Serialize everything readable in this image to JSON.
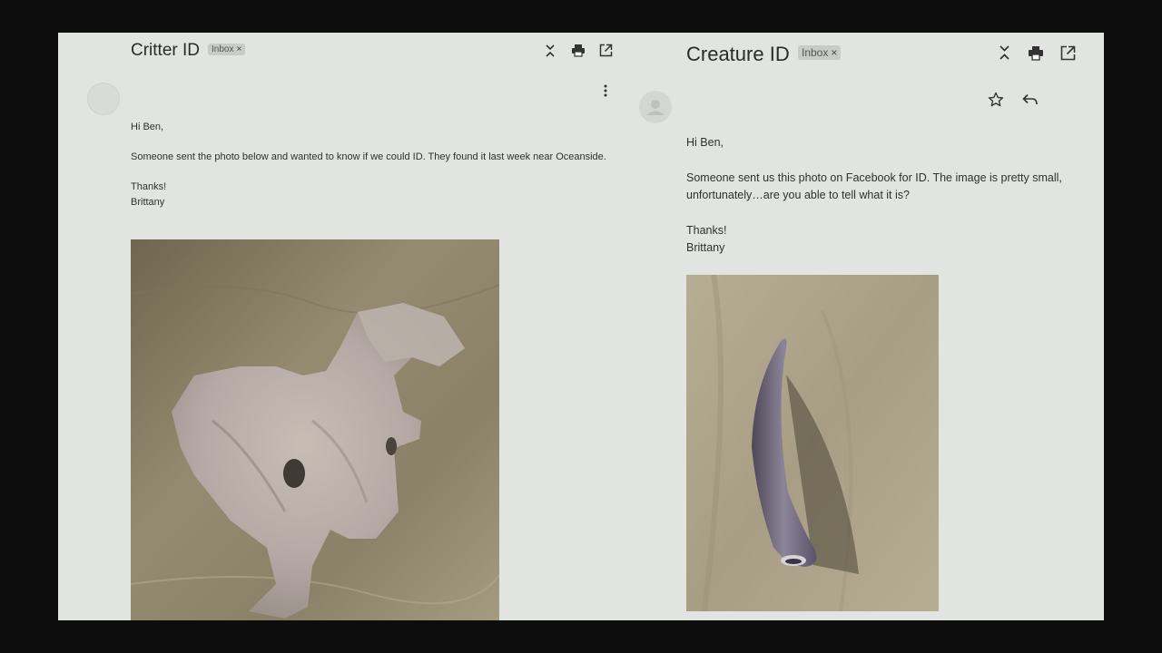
{
  "left_email": {
    "subject": "Critter ID",
    "label_chip": "Inbox",
    "chip_close": "×",
    "icons": [
      "expand-collapse-icon",
      "print-icon",
      "open-in-new-window-icon",
      "more-vert-icon"
    ],
    "greeting": "Hi Ben,",
    "body": "Someone sent the photo below and wanted to know if we could ID. They found it last week near Oceanside.",
    "signoff": "Thanks!",
    "signature": "Brittany"
  },
  "right_email": {
    "subject": "Creature ID",
    "label_chip": "Inbox",
    "chip_close": "×",
    "icons": [
      "expand-collapse-icon",
      "print-icon",
      "open-in-new-window-icon",
      "star-icon",
      "reply-icon",
      "more-vert-icon",
      "avatar-icon"
    ],
    "greeting": "Hi Ben,",
    "body_line1": "Someone sent us this photo on Facebook for ID. The image is pretty small,",
    "body_line2": "unfortunately…are you able to tell what it is?",
    "signoff": "Thanks!",
    "signature": "Brittany"
  },
  "colors": {
    "background": "#e2e4e1",
    "chip": "#c9cbc8",
    "sand": "#a39a80",
    "frame": "#0d0d0d"
  }
}
